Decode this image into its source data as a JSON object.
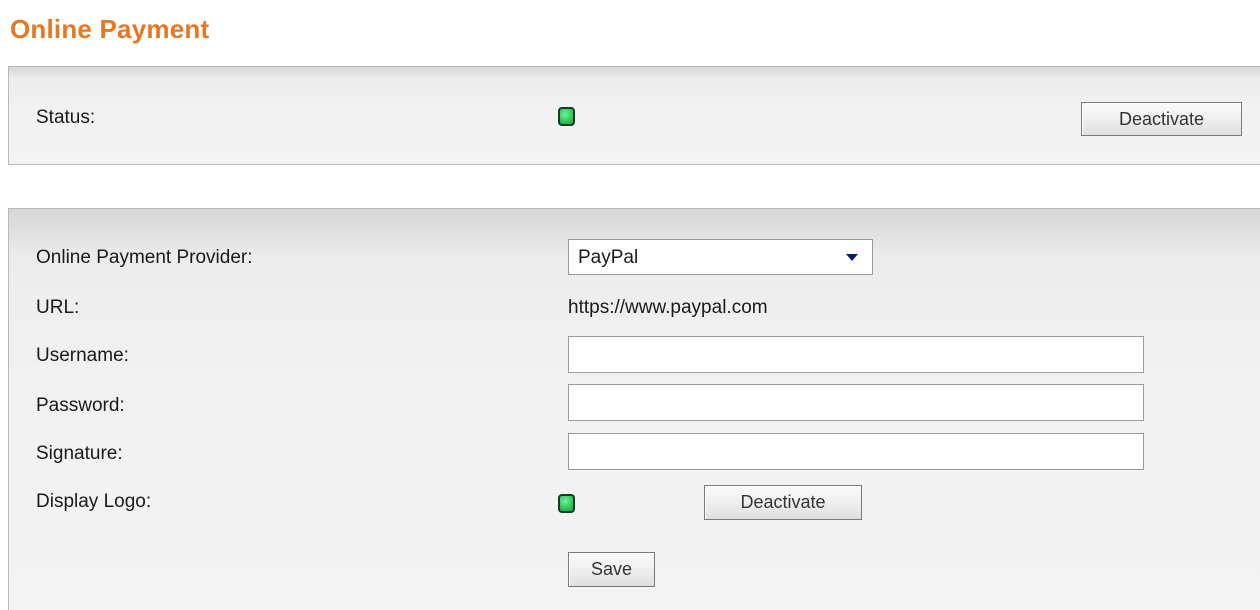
{
  "header": {
    "title": "Online Payment"
  },
  "status_panel": {
    "status_label": "Status:",
    "status_indicator": "active",
    "deactivate_label": "Deactivate"
  },
  "settings": {
    "provider_label": "Online Payment Provider:",
    "provider_value": "PayPal",
    "url_label": "URL:",
    "url_value": "https://www.paypal.com",
    "username_label": "Username:",
    "username_value": "",
    "password_label": "Password:",
    "password_value": "",
    "signature_label": "Signature:",
    "signature_value": "",
    "display_logo_label": "Display Logo:",
    "display_logo_indicator": "active",
    "display_logo_deactivate_label": "Deactivate",
    "save_label": "Save"
  },
  "colors": {
    "title": "#e87722",
    "indicator_active": "#2fcc5e"
  }
}
